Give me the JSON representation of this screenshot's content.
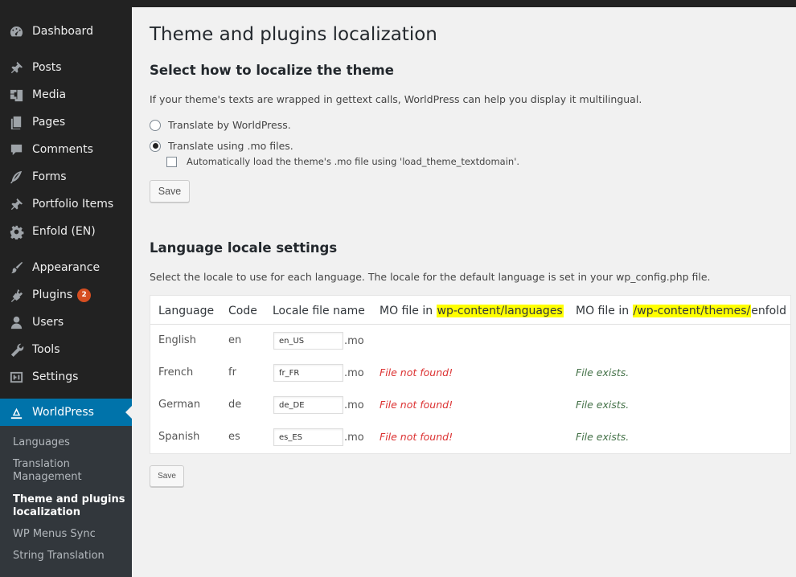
{
  "sidebar": {
    "items": [
      {
        "label": "Dashboard",
        "icon": "dashboard-icon"
      },
      {
        "label": "Posts",
        "icon": "pin-icon"
      },
      {
        "label": "Media",
        "icon": "media-icon"
      },
      {
        "label": "Pages",
        "icon": "pages-icon"
      },
      {
        "label": "Comments",
        "icon": "comment-icon"
      },
      {
        "label": "Forms",
        "icon": "feather-icon"
      },
      {
        "label": "Portfolio Items",
        "icon": "pin-icon"
      },
      {
        "label": "Enfold (EN)",
        "icon": "gear-icon"
      },
      {
        "label": "Appearance",
        "icon": "brush-icon"
      },
      {
        "label": "Plugins",
        "icon": "plug-icon",
        "badge": "2"
      },
      {
        "label": "Users",
        "icon": "user-icon"
      },
      {
        "label": "Tools",
        "icon": "wrench-icon"
      },
      {
        "label": "Settings",
        "icon": "settings-icon"
      },
      {
        "label": "WorldPress",
        "icon": "wordpress-icon"
      }
    ],
    "submenu": [
      {
        "label": "Languages"
      },
      {
        "label": "Translation Management"
      },
      {
        "label": "Theme and plugins localization"
      },
      {
        "label": "WP Menus Sync"
      },
      {
        "label": "String Translation"
      }
    ],
    "colors": {
      "active": "#0073aa",
      "badge": "#d54e21",
      "background": "#222222"
    }
  },
  "main": {
    "title": "Theme and plugins localization",
    "theme_section": {
      "heading": "Select how to localize the theme",
      "description": "If your theme's texts are wrapped in gettext calls, WorldPress can help you display it multilingual.",
      "option_wp": "Translate by WorldPress.",
      "option_mo": "Translate using .mo files.",
      "selected": "Translate using .mo files.",
      "autoload_label": "Automatically load the theme's .mo file using 'load_theme_textdomain'.",
      "autoload_checked": false,
      "save_label": "Save"
    },
    "locale_section": {
      "heading": "Language locale settings",
      "description": "Select the locale to use for each language. The locale for the default language is set in your wp_config.php file.",
      "headers": {
        "language": "Language",
        "code": "Code",
        "locale": "Locale file name",
        "mo_lang_prefix": "MO file in ",
        "mo_lang_path": "wp-content/languages",
        "mo_theme_prefix": "MO file in ",
        "mo_theme_path": "/wp-content/themes/",
        "mo_theme_suffix": "enfold"
      },
      "rows": [
        {
          "language": "English",
          "code": "en",
          "locale": "en_US",
          "ext": ".mo",
          "mo_lang": "",
          "mo_theme": ""
        },
        {
          "language": "French",
          "code": "fr",
          "locale": "fr_FR",
          "ext": ".mo",
          "mo_lang": "File not found!",
          "mo_theme": "File exists."
        },
        {
          "language": "German",
          "code": "de",
          "locale": "de_DE",
          "ext": ".mo",
          "mo_lang": "File not found!",
          "mo_theme": "File exists."
        },
        {
          "language": "Spanish",
          "code": "es",
          "locale": "es_ES",
          "ext": ".mo",
          "mo_lang": "File not found!",
          "mo_theme": "File exists."
        }
      ],
      "save_label": "Save",
      "colors": {
        "highlight": "#ffff00",
        "error": "#dc3232",
        "success": "#46734a"
      }
    }
  }
}
